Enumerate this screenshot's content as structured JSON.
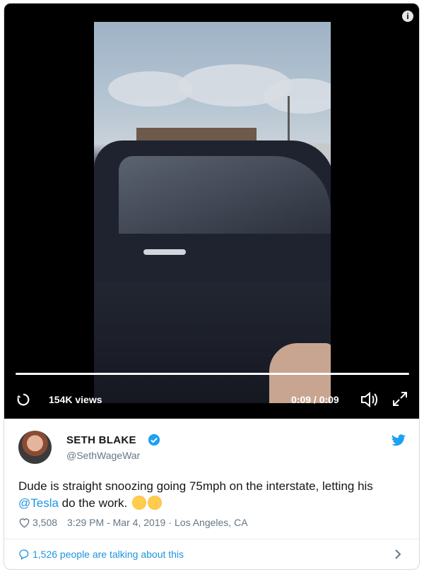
{
  "video": {
    "views": "154K views",
    "time": "0:09 / 0:09",
    "progress": 1.0
  },
  "tweet": {
    "name": "SETH BLAKE",
    "handle": "@SethWageWar",
    "text_before": "Dude is straight snoozing going 75mph on the interstate, letting his ",
    "mention": "@Tesla",
    "text_after": " do the work. ",
    "likes": "3,508",
    "time": "3:29 PM - Mar 4, 2019",
    "separator": "·",
    "location": "Los Angeles, CA",
    "talking": "1,526 people are talking about this"
  },
  "icons": {
    "info": "info-icon",
    "replay": "replay-icon",
    "volume": "volume-icon",
    "fullscreen": "fullscreen-icon",
    "verified": "verified-icon",
    "twitter": "twitter-bird-icon",
    "heart": "heart-icon",
    "comment": "comment-icon",
    "chevron": "chevron-right-icon"
  },
  "colors": {
    "accent": "#1b95e0",
    "text": "#14171a",
    "muted": "#657786"
  }
}
